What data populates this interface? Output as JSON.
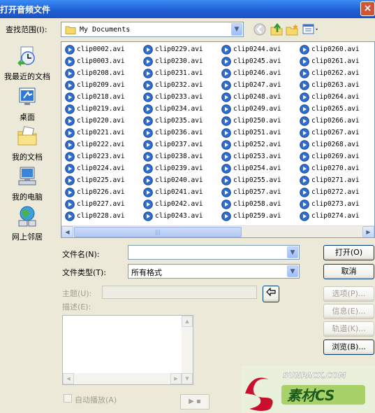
{
  "window": {
    "title": "打开音频文件",
    "close_glyph": "×"
  },
  "lookin": {
    "label": "查找范围(I):",
    "value": "My Documents"
  },
  "places": [
    {
      "label": "我最近的文档"
    },
    {
      "label": "桌面"
    },
    {
      "label": "我的文档"
    },
    {
      "label": "我的电脑"
    },
    {
      "label": "网上邻居"
    }
  ],
  "files": {
    "columns": [
      [
        "clip0002.avi",
        "clip0003.avi",
        "clip0208.avi",
        "clip0209.avi",
        "clip0218.avi",
        "clip0219.avi",
        "clip0220.avi",
        "clip0221.avi",
        "clip0222.avi",
        "clip0223.avi",
        "clip0224.avi",
        "clip0225.avi",
        "clip0226.avi",
        "clip0227.avi",
        "clip0228.avi"
      ],
      [
        "clip0229.avi",
        "clip0230.avi",
        "clip0231.avi",
        "clip0232.avi",
        "clip0233.avi",
        "clip0234.avi",
        "clip0235.avi",
        "clip0236.avi",
        "clip0237.avi",
        "clip0238.avi",
        "clip0239.avi",
        "clip0240.avi",
        "clip0241.avi",
        "clip0242.avi",
        "clip0243.avi"
      ],
      [
        "clip0244.avi",
        "clip0245.avi",
        "clip0246.avi",
        "clip0247.avi",
        "clip0248.avi",
        "clip0249.avi",
        "clip0250.avi",
        "clip0251.avi",
        "clip0252.avi",
        "clip0253.avi",
        "clip0254.avi",
        "clip0255.avi",
        "clip0257.avi",
        "clip0258.avi",
        "clip0259.avi"
      ],
      [
        "clip0260.avi",
        "clip0261.avi",
        "clip0262.avi",
        "clip0263.avi",
        "clip0264.avi",
        "clip0265.avi",
        "clip0266.avi",
        "clip0267.avi",
        "clip0268.avi",
        "clip0269.avi",
        "clip0270.avi",
        "clip0271.avi",
        "clip0272.avi",
        "clip0273.avi",
        "clip0274.avi"
      ]
    ]
  },
  "filename": {
    "label": "文件名(N):",
    "value": ""
  },
  "filetype": {
    "label": "文件类型(T):",
    "value": "所有格式"
  },
  "buttons": {
    "open": "打开(O)",
    "cancel": "取消",
    "options": "选项(P)...",
    "info": "信息(E)...",
    "tracks": "轨道(K)...",
    "browse": "浏览(B)..."
  },
  "meta": {
    "subject_label": "主题(U):",
    "desc_label": "描述(E):"
  },
  "autoplay": {
    "label": "自动播放(A)",
    "checked": false
  },
  "play_button": {
    "glyph": "▶ ▪"
  },
  "watermark": {
    "line1": "SUNPACK.COM",
    "line2": "素材CS"
  },
  "colors": {
    "title_bar": "#1f5fd6",
    "face": "#ece9d8",
    "border": "#7f9db9"
  }
}
